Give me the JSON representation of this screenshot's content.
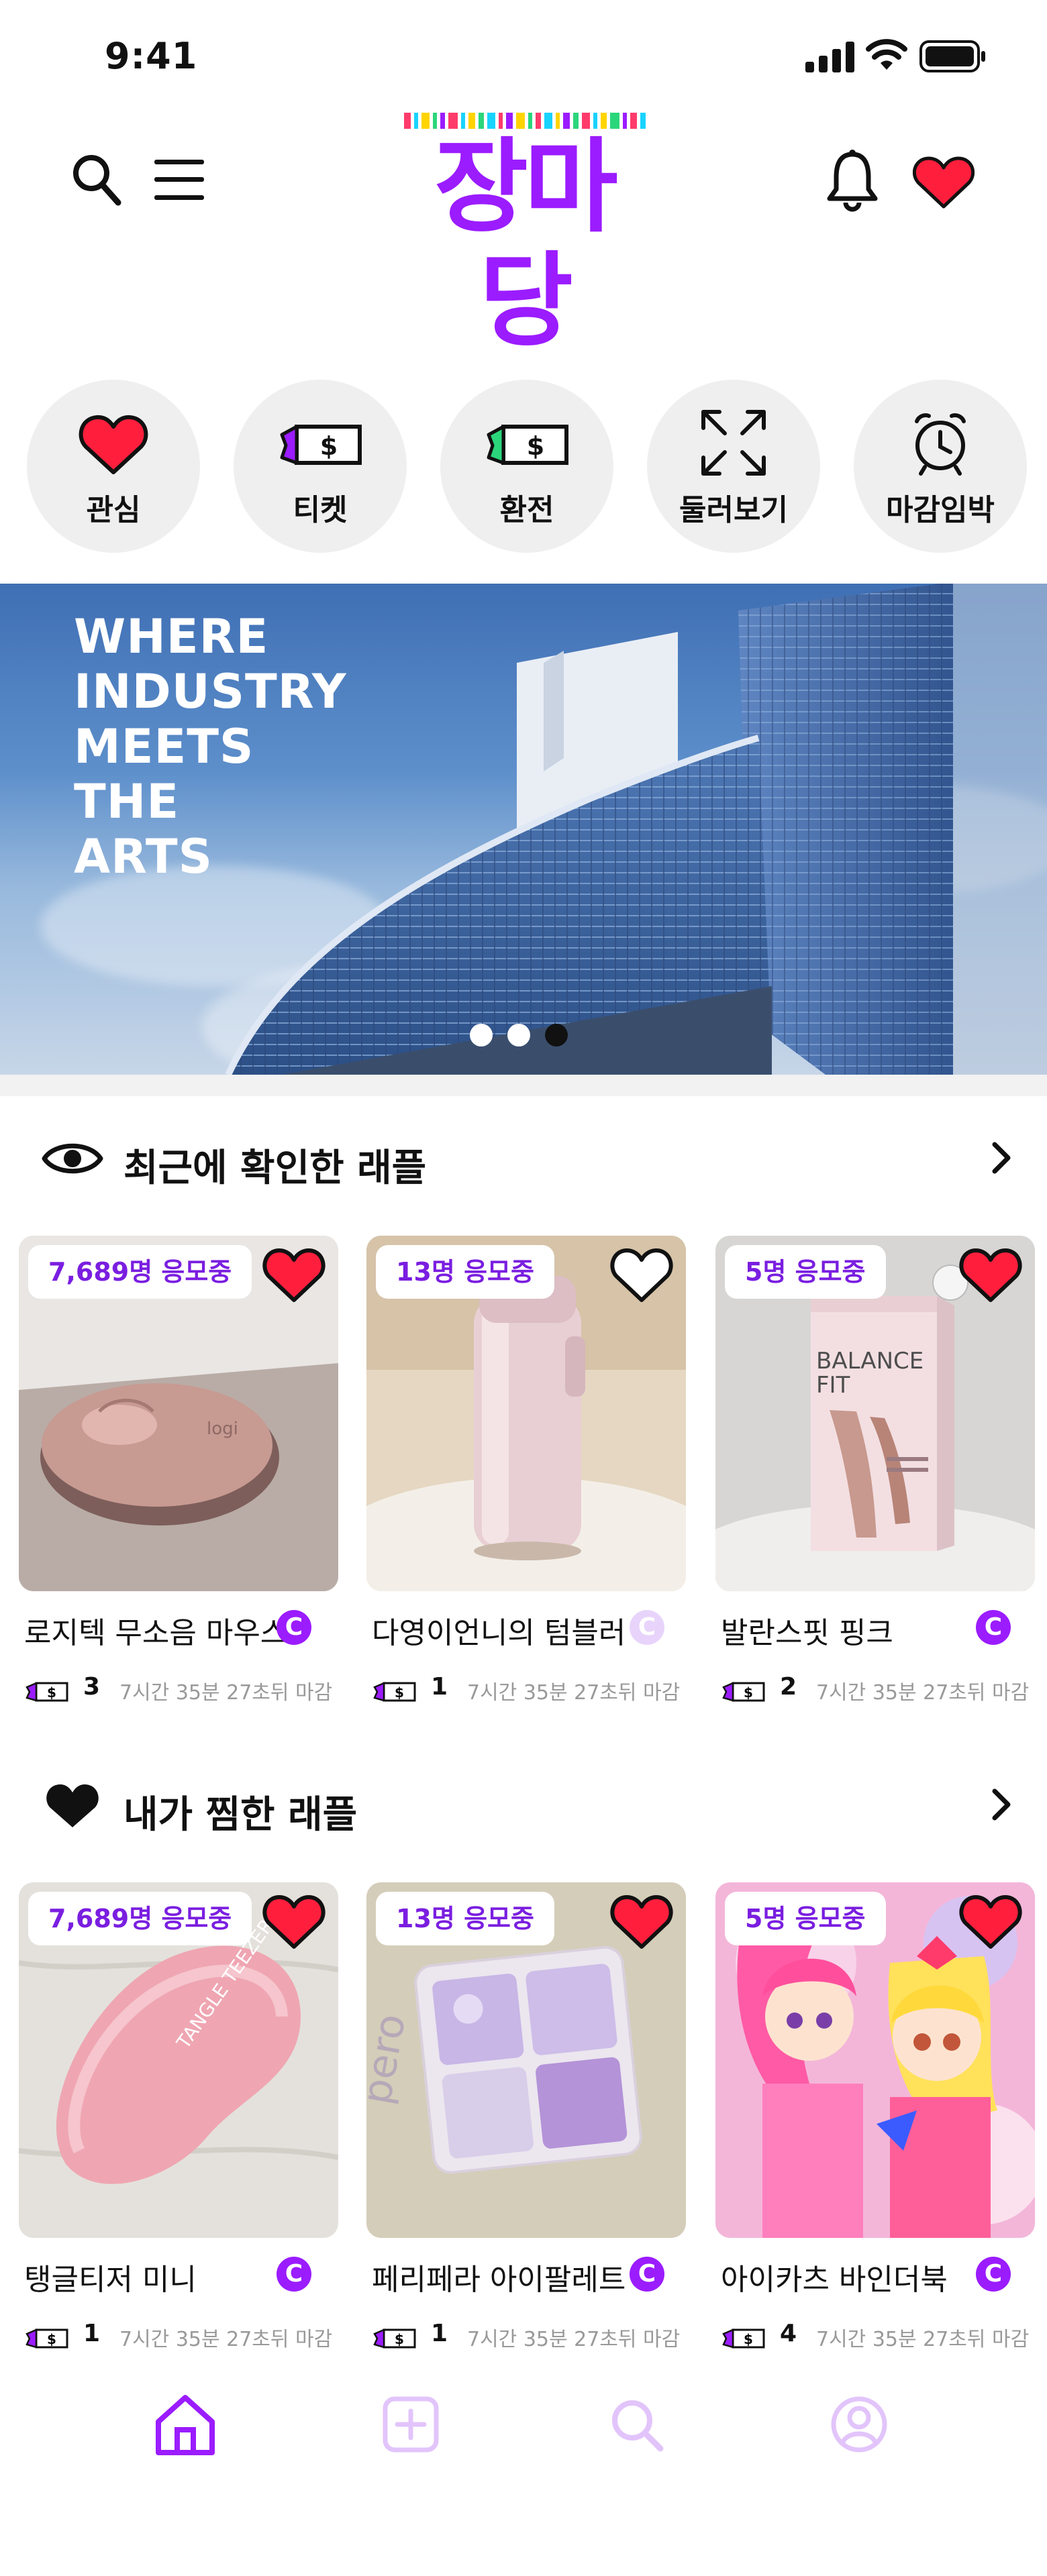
{
  "status_bar": {
    "time": "9:41"
  },
  "header": {
    "logo_text": "장마당",
    "logo_bar_colors": [
      "#ff3b6b",
      "#19d3ff",
      "#ffd400",
      "#2bd67b",
      "#9b1cff"
    ]
  },
  "quick_menu": [
    {
      "label": "관심",
      "icon": "heart-icon"
    },
    {
      "label": "티켓",
      "icon": "ticket-icon"
    },
    {
      "label": "환전",
      "icon": "exchange-ticket-icon"
    },
    {
      "label": "둘러보기",
      "icon": "expand-arrows-icon"
    },
    {
      "label": "마감임박",
      "icon": "alarm-clock-icon"
    }
  ],
  "banner": {
    "lines": [
      "WHERE",
      "INDUSTRY",
      "MEETS",
      "THE",
      "ARTS"
    ],
    "page_count": 3,
    "active_page": 3
  },
  "recent_section": {
    "title": "최근에 확인한 래플",
    "items": [
      {
        "badge": "7,689명 응모중",
        "name": "로지텍 무소음 마우스",
        "tickets": "3",
        "deadline": "7시간 35분 27초뒤 마감",
        "liked": true,
        "c": "C",
        "c_active": true
      },
      {
        "badge": "13명 응모중",
        "name": "다영이언니의 텀블러",
        "tickets": "1",
        "deadline": "7시간 35분 27초뒤 마감",
        "liked": false,
        "c": "C",
        "c_active": false
      },
      {
        "badge": "5명 응모중",
        "name": "발란스핏 핑크",
        "tickets": "2",
        "deadline": "7시간 35분 27초뒤 마감",
        "liked": true,
        "c": "C",
        "c_active": true
      }
    ],
    "product_label": [
      "BALANCE",
      "FIT"
    ]
  },
  "liked_section": {
    "title": "내가 찜한 래플",
    "items": [
      {
        "badge": "7,689명 응모중",
        "name": "탱글티저 미니",
        "tickets": "1",
        "deadline": "7시간 35분 27초뒤 마감",
        "liked": true,
        "c": "C",
        "c_active": true
      },
      {
        "badge": "13명 응모중",
        "name": "페리페라 아이팔레트",
        "tickets": "1",
        "deadline": "7시간 35분 27초뒤 마감",
        "liked": true,
        "c": "C",
        "c_active": true
      },
      {
        "badge": "5명 응모중",
        "name": "아이카츠 바인더북",
        "tickets": "4",
        "deadline": "7시간 35분 27초뒤 마감",
        "liked": true,
        "c": "C",
        "c_active": true
      }
    ]
  },
  "tab_bar": [
    {
      "name": "home",
      "icon": "home-icon",
      "active": true
    },
    {
      "name": "add",
      "icon": "plus-square-icon",
      "active": false
    },
    {
      "name": "search",
      "icon": "search-icon",
      "active": false
    },
    {
      "name": "profile",
      "icon": "profile-icon",
      "active": false
    }
  ],
  "colors": {
    "accent": "#9b1cff",
    "heart": "#ff1f3d",
    "badge_text": "#7a1ee0",
    "inactive_tab": "#e2c4fb"
  }
}
